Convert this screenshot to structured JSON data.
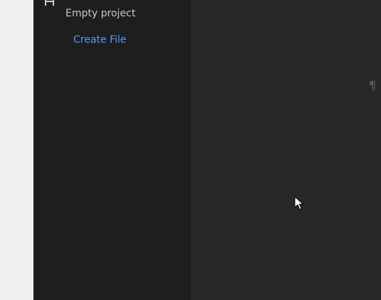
{
  "sidebar": {
    "top_icon": "home-icon",
    "empty_label": "Empty project",
    "create_file_label": "Create File"
  },
  "editor": {
    "pilcrow": "¶",
    "pointer_icon": "mouse-pointer-icon"
  },
  "colors": {
    "sidebar_bg": "#1e1e1e",
    "editor_bg": "#282828",
    "gutter_bg": "#efefef",
    "link": "#4ea1f3",
    "label": "#c7c7c7"
  }
}
